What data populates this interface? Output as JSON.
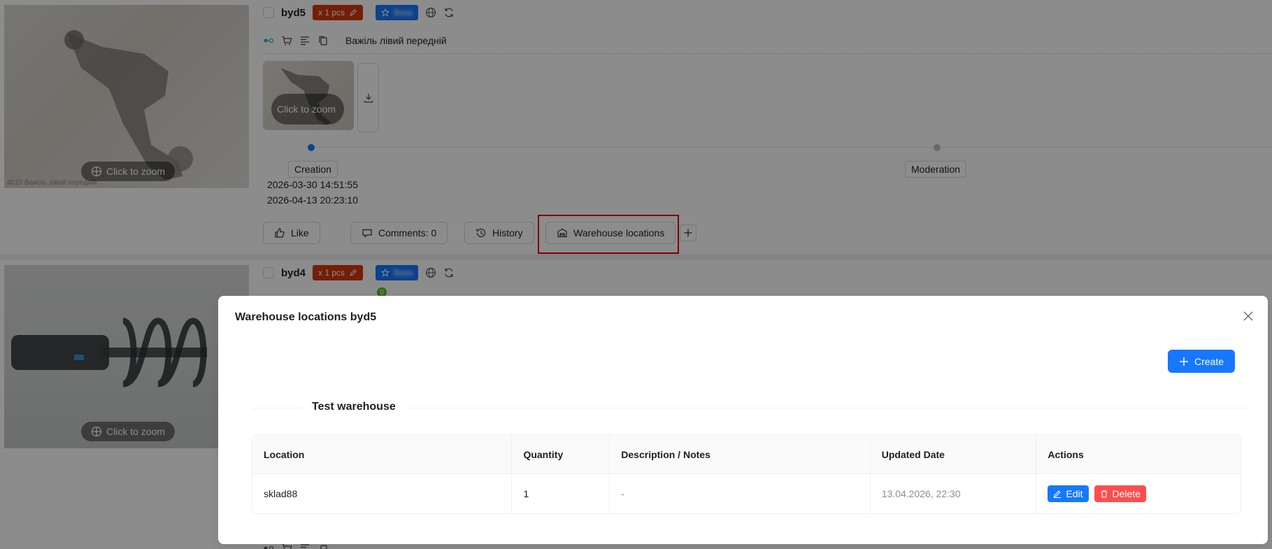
{
  "items": [
    {
      "sku": "byd5",
      "qty_tag": "x 1 pcs",
      "brand_tag": "Base",
      "part_name": "Важіль лівий передній",
      "image_zoom_label": "Click to zoom",
      "photo_caption": "4010 Важіль лівий передній",
      "thumb_zoom_label": "Click to zoom",
      "steps": [
        "Creation",
        "Moderation"
      ],
      "dates": [
        "2026-03-30 14:51:55",
        "2026-04-13 20:23:10"
      ],
      "actions": {
        "like": "Like",
        "comments": "Comments: 0",
        "history": "History",
        "warehouse": "Warehouse locations"
      }
    },
    {
      "sku": "byd4",
      "qty_tag": "x 1 pcs",
      "brand_tag": "Base",
      "image_zoom_label": "Click to zoom",
      "badge_count": "0"
    }
  ],
  "modal": {
    "title": "Warehouse locations byd5",
    "create_label": "Create",
    "warehouse_name": "Test warehouse",
    "columns": [
      "Location",
      "Quantity",
      "Description / Notes",
      "Updated Date",
      "Actions"
    ],
    "rows": [
      {
        "location": "sklad88",
        "quantity": "1",
        "notes": "-",
        "updated": "13.04.2026, 22:30",
        "edit_label": "Edit",
        "delete_label": "Delete"
      }
    ]
  },
  "colors": {
    "primary": "#1677ff",
    "danger": "#ff4d4f",
    "qty_tag": "#d4380d",
    "highlight": "#e00000"
  }
}
